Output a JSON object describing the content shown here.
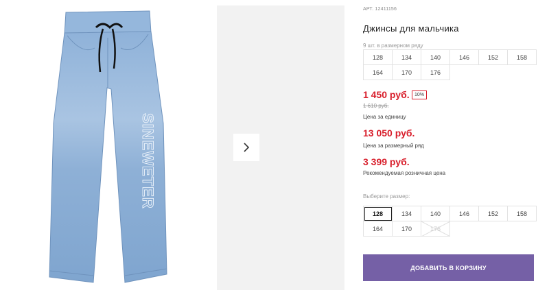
{
  "product": {
    "sku": "АРТ. 12411156",
    "title": "Джинсы для мальчика",
    "print_text": "SINEWETER"
  },
  "size_row": {
    "note": "9 шт. в размерном ряду",
    "sizes": [
      "128",
      "134",
      "140",
      "146",
      "152",
      "158",
      "164",
      "170",
      "176"
    ]
  },
  "pricing": {
    "unit_price": "1 450 руб.",
    "discount": "10%",
    "old_price": "1 610 руб.",
    "unit_caption": "Цена за единицу",
    "row_price": "13 050 руб.",
    "row_caption": "Цена за размерный ряд",
    "retail_price": "3 399 руб.",
    "retail_caption": "Рекомендуемая розничная цена"
  },
  "size_picker": {
    "label": "Выберите размер:",
    "selected": "128",
    "sizes": [
      {
        "value": "128",
        "available": true
      },
      {
        "value": "134",
        "available": true
      },
      {
        "value": "140",
        "available": true
      },
      {
        "value": "146",
        "available": true
      },
      {
        "value": "152",
        "available": true
      },
      {
        "value": "158",
        "available": true
      },
      {
        "value": "164",
        "available": true
      },
      {
        "value": "170",
        "available": true
      },
      {
        "value": "176",
        "available": false
      }
    ]
  },
  "cart": {
    "button_label": "ДОБАВИТЬ В КОРЗИНУ"
  },
  "colors": {
    "price_red": "#d81e2b",
    "button_purple": "#7560a6",
    "denim": "#8fb2d6"
  },
  "gallery": {
    "next_icon": "chevron-right-icon"
  }
}
